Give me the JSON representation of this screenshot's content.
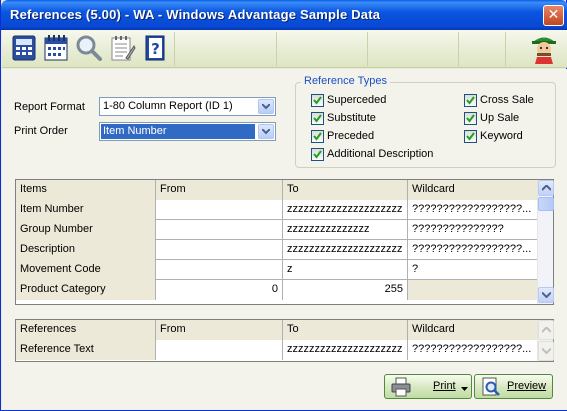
{
  "window": {
    "title": "References (5.00) - WA - Windows Advantage Sample Data",
    "close_glyph": "✕"
  },
  "toolbar": {
    "buttons": [
      {
        "icon": "calculator-icon"
      },
      {
        "icon": "calendar-icon"
      },
      {
        "icon": "magnifier-icon"
      },
      {
        "icon": "notepad-icon"
      },
      {
        "icon": "help-book-icon"
      }
    ],
    "mascot_icon": "mascot-icon"
  },
  "form": {
    "report_format_label": "Report Format",
    "report_format_value": "1-80 Column Report (ID 1)",
    "print_order_label": "Print Order",
    "print_order_value": "Item Number"
  },
  "reference_types": {
    "title": "Reference Types",
    "options": [
      {
        "label": "Superceded",
        "checked": true
      },
      {
        "label": "Substitute",
        "checked": true
      },
      {
        "label": "Preceded",
        "checked": true
      },
      {
        "label": "Additional Description",
        "checked": true
      },
      {
        "label": "Cross Sale",
        "checked": true
      },
      {
        "label": "Up Sale",
        "checked": true
      },
      {
        "label": "Keyword",
        "checked": true
      }
    ]
  },
  "items_grid": {
    "headers": [
      "Items",
      "From",
      "To",
      "Wildcard"
    ],
    "rows": [
      {
        "name": "Item Number",
        "from": "",
        "to": "zzzzzzzzzzzzzzzzzzzzz",
        "wildcard": "??????????????????..."
      },
      {
        "name": "Group Number",
        "from": "",
        "to": "zzzzzzzzzzzzzzz",
        "wildcard": "???????????????"
      },
      {
        "name": "Description",
        "from": "",
        "to": "zzzzzzzzzzzzzzzzzzzzz",
        "wildcard": "??????????????????..."
      },
      {
        "name": "Movement Code",
        "from": "",
        "to": "z",
        "wildcard": "?"
      },
      {
        "name": "Product Category",
        "from": "0",
        "to": "255",
        "wildcard": ""
      }
    ]
  },
  "references_grid": {
    "headers": [
      "References",
      "From",
      "To",
      "Wildcard"
    ],
    "rows": [
      {
        "name": "Reference Text",
        "from": "",
        "to": "zzzzzzzzzzzzzzzzzzzzz",
        "wildcard": "??????????????????..."
      }
    ]
  },
  "actions": {
    "print_label": "Print",
    "preview_label": "Preview"
  },
  "colors": {
    "title_bar": "#0b55e0",
    "accent_blue": "#1c4fc4",
    "selection": "#316ac5",
    "button_green": "#c1dca3"
  }
}
